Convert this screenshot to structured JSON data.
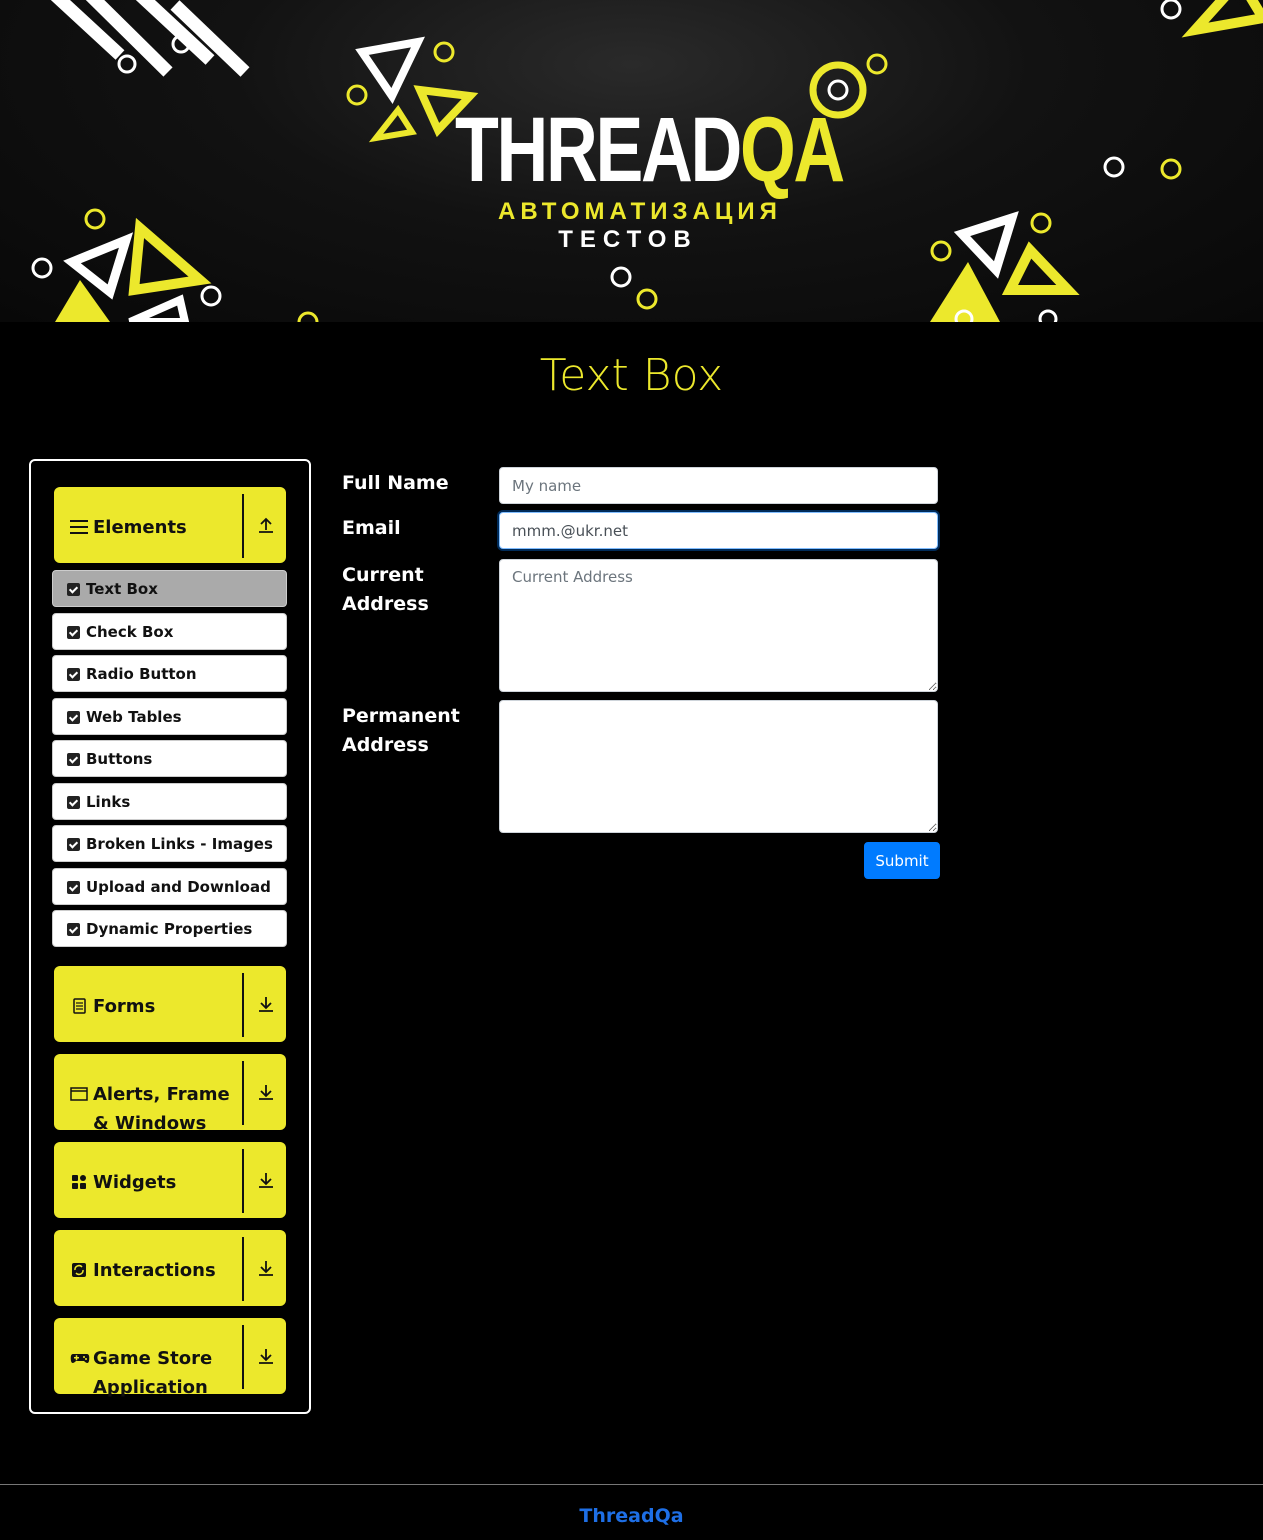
{
  "banner": {
    "logo_white": "THREAD",
    "logo_yellow": "QA",
    "subtitle_line1": "АВТОМАТИЗАЦИЯ",
    "subtitle_line2": "ТЕСТОВ"
  },
  "page": {
    "title": "Text Box"
  },
  "sidebar": {
    "groups": [
      {
        "label": "Elements",
        "icon": "menu-icon",
        "arrow": "arrow-up-icon",
        "expanded": true
      },
      {
        "label": "Forms",
        "icon": "document-icon",
        "arrow": "arrow-down-icon"
      },
      {
        "label": "Alerts, Frame & Windows",
        "icon": "window-icon",
        "arrow": "arrow-down-icon"
      },
      {
        "label": "Widgets",
        "icon": "grid-icon",
        "arrow": "arrow-down-icon"
      },
      {
        "label": "Interactions",
        "icon": "repeat-icon",
        "arrow": "arrow-down-icon"
      },
      {
        "label": "Game Store Application",
        "icon": "gamepad-icon",
        "arrow": "arrow-down-icon"
      }
    ],
    "items": [
      {
        "label": "Text Box",
        "active": true
      },
      {
        "label": "Check Box"
      },
      {
        "label": "Radio Button"
      },
      {
        "label": "Web Tables"
      },
      {
        "label": "Buttons"
      },
      {
        "label": "Links"
      },
      {
        "label": "Broken Links - Images"
      },
      {
        "label": "Upload and Download"
      },
      {
        "label": "Dynamic Properties"
      }
    ]
  },
  "form": {
    "full_name": {
      "label": "Full Name",
      "value": "",
      "placeholder": "My name"
    },
    "email": {
      "label": "Email",
      "value": "mmm.@ukr.net",
      "placeholder": ""
    },
    "current_address": {
      "label": "Current Address",
      "value": "",
      "placeholder": "Current Address"
    },
    "permanent_address": {
      "label": "Permanent Address",
      "value": "",
      "placeholder": ""
    },
    "submit_label": "Submit"
  },
  "footer": {
    "text": "ThreadQa"
  },
  "colors": {
    "accent": "#ece82c",
    "button": "#007bff",
    "footer_link": "#1e6fe6",
    "background": "#000000"
  }
}
